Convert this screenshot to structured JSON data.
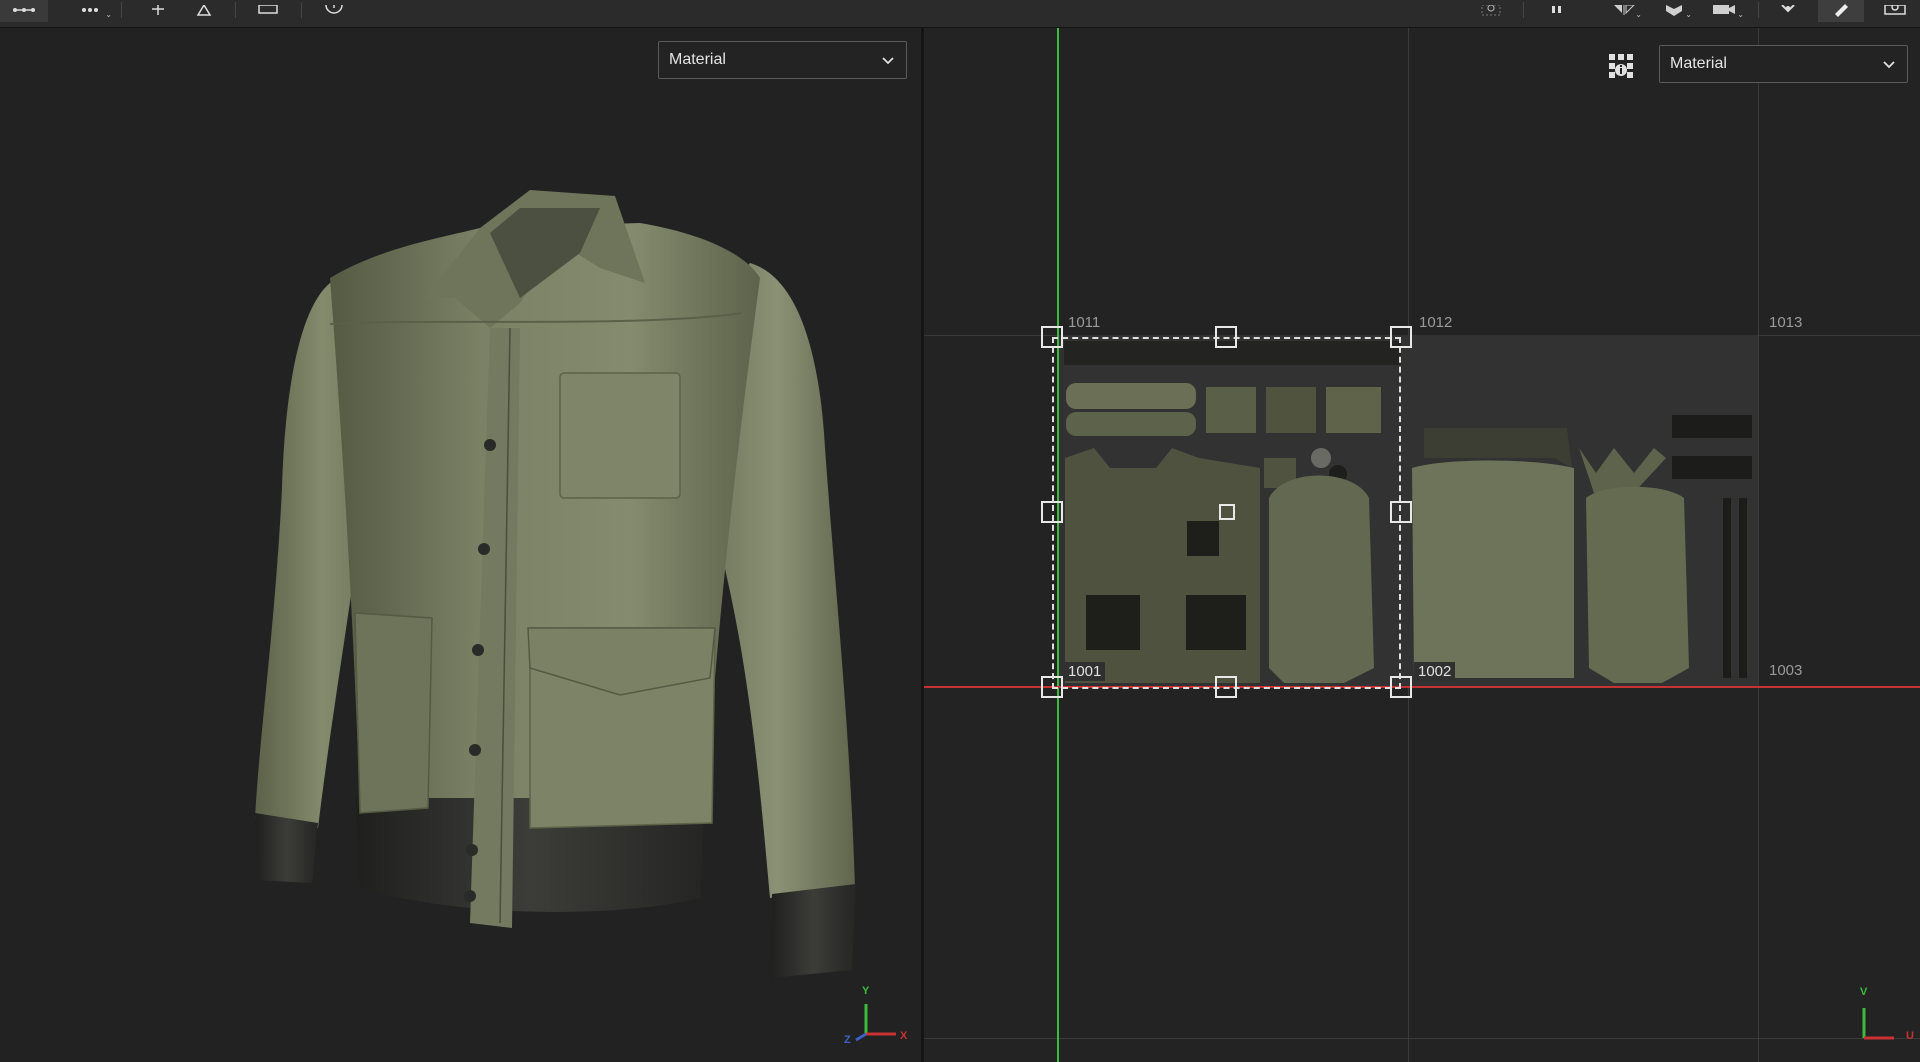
{
  "toolbar": {
    "left_icons": [
      "edit-uv-icon",
      "more-tools-icon",
      "pin-icon",
      "triangle-icon",
      "frame-icon",
      "clock-icon"
    ],
    "right_icons": [
      "zoom-frame-icon",
      "pause-icon",
      "mirror-icon",
      "cube-icon",
      "camera-icon",
      "burst-icon",
      "brush-icon",
      "screenshot-icon"
    ]
  },
  "left_viewport": {
    "render_mode": "Material",
    "axis": {
      "y": "Y",
      "x": "X",
      "z": "Z"
    }
  },
  "right_viewport": {
    "render_mode": "Material",
    "tiles": {
      "t1011": "1011",
      "t1012": "1012",
      "t1013": "1013",
      "t1001": "1001",
      "t1002": "1002",
      "t1003": "1003"
    },
    "axis": {
      "v": "V",
      "u": "U"
    }
  },
  "colors": {
    "background": "#222223",
    "fabric": "#737a5f",
    "rib": "#2f302d",
    "v_axis": "#3dbb3d",
    "u_axis": "#c83232"
  }
}
